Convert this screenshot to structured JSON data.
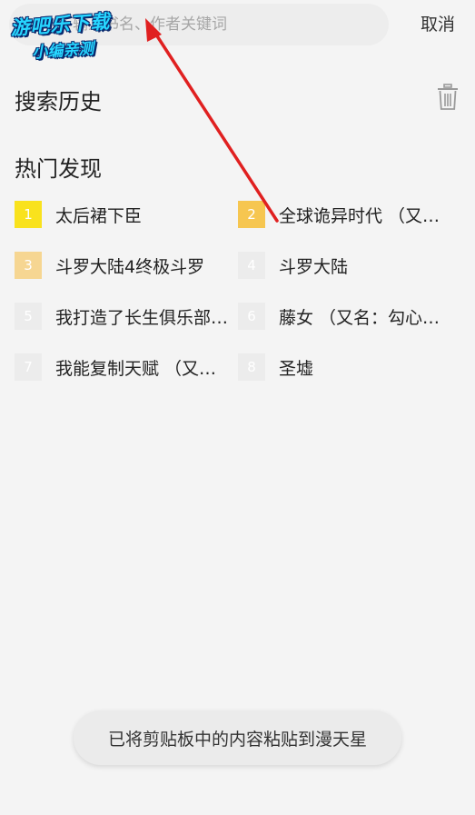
{
  "search": {
    "value": "",
    "placeholder": "输入书名、作者关键词",
    "cancel_label": "取消"
  },
  "watermark": {
    "line1": "游吧乐下载",
    "line2": "小编亲测"
  },
  "history": {
    "title": "搜索历史",
    "clear_icon": "trash-icon"
  },
  "hot": {
    "title": "热门发现",
    "items": [
      {
        "rank": "1",
        "title": "太后裙下臣",
        "badge_color": "#f9e21d"
      },
      {
        "rank": "2",
        "title": "全球诡异时代 （又名…",
        "badge_color": "#f6c650"
      },
      {
        "rank": "3",
        "title": "斗罗大陆4终极斗罗",
        "badge_color": "#f6d692"
      },
      {
        "rank": "4",
        "title": "斗罗大陆",
        "badge_color": "#ececec"
      },
      {
        "rank": "5",
        "title": "我打造了长生俱乐部…",
        "badge_color": "#ececec"
      },
      {
        "rank": "6",
        "title": "藤女 （又名：勾心斗…",
        "badge_color": "#ececec"
      },
      {
        "rank": "7",
        "title": "我能复制天赋 （又名…",
        "badge_color": "#ececec"
      },
      {
        "rank": "8",
        "title": "圣墟",
        "badge_color": "#ececec"
      }
    ]
  },
  "toast": {
    "message": "已将剪贴板中的内容粘贴到漫天星"
  },
  "colors": {
    "background": "#f4f4f4",
    "arrow": "#e02020"
  }
}
